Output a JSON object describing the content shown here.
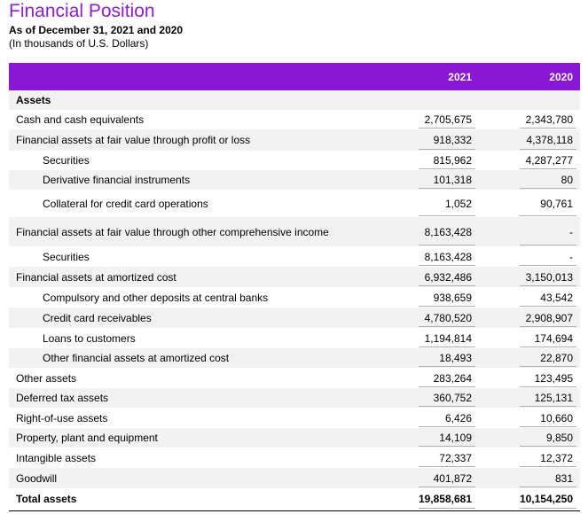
{
  "title": "Financial Position",
  "subtitle": "As of December 31, 2021 and 2020",
  "note": "(In thousands of U.S. Dollars)",
  "columns": [
    "2021",
    "2020"
  ],
  "colors": {
    "header": "#8a17d6",
    "title": "#8b1fd1",
    "shade": "#f2f2f2"
  },
  "rows": [
    {
      "label": "Assets",
      "v2021": "",
      "v2020": "",
      "bold": true,
      "indent": false
    },
    {
      "label": "Cash and cash equivalents",
      "v2021": "2,705,675",
      "v2020": "2,343,780",
      "bold": false,
      "indent": false
    },
    {
      "label": "Financial assets at fair value through profit or loss",
      "v2021": "918,332",
      "v2020": "4,378,118",
      "bold": false,
      "indent": false
    },
    {
      "label": "Securities",
      "v2021": "815,962",
      "v2020": "4,287,277",
      "bold": false,
      "indent": true
    },
    {
      "label": "Derivative financial instruments",
      "v2021": "101,318",
      "v2020": "80",
      "bold": false,
      "indent": true
    },
    {
      "label": "Collateral for credit card operations",
      "v2021": "1,052",
      "v2020": "90,761",
      "bold": false,
      "indent": true
    },
    {
      "label": "Financial assets at fair value through other comprehensive income",
      "v2021": "8,163,428",
      "v2020": "-",
      "bold": false,
      "indent": false
    },
    {
      "label": "Securities",
      "v2021": "8,163,428",
      "v2020": "-",
      "bold": false,
      "indent": true
    },
    {
      "label": "Financial assets at amortized cost",
      "v2021": "6,932,486",
      "v2020": "3,150,013",
      "bold": false,
      "indent": false
    },
    {
      "label": "Compulsory and other deposits at central banks",
      "v2021": "938,659",
      "v2020": "43,542",
      "bold": false,
      "indent": true
    },
    {
      "label": "Credit card receivables",
      "v2021": "4,780,520",
      "v2020": "2,908,907",
      "bold": false,
      "indent": true
    },
    {
      "label": "Loans to customers",
      "v2021": "1,194,814",
      "v2020": "174,694",
      "bold": false,
      "indent": true
    },
    {
      "label": "Other financial assets at amortized cost",
      "v2021": "18,493",
      "v2020": "22,870",
      "bold": false,
      "indent": true
    },
    {
      "label": "Other assets",
      "v2021": "283,264",
      "v2020": "123,495",
      "bold": false,
      "indent": false
    },
    {
      "label": "Deferred tax assets",
      "v2021": "360,752",
      "v2020": "125,131",
      "bold": false,
      "indent": false
    },
    {
      "label": "Right-of-use assets",
      "v2021": "6,426",
      "v2020": "10,660",
      "bold": false,
      "indent": false
    },
    {
      "label": "Property, plant and equipment",
      "v2021": "14,109",
      "v2020": "9,850",
      "bold": false,
      "indent": false
    },
    {
      "label": "Intangible assets",
      "v2021": "72,337",
      "v2020": "12,372",
      "bold": false,
      "indent": false
    },
    {
      "label": "Goodwill",
      "v2021": "401,872",
      "v2020": "831",
      "bold": false,
      "indent": false
    },
    {
      "label": "Total assets",
      "v2021": "19,858,681",
      "v2020": "10,154,250",
      "bold": true,
      "indent": false
    }
  ]
}
